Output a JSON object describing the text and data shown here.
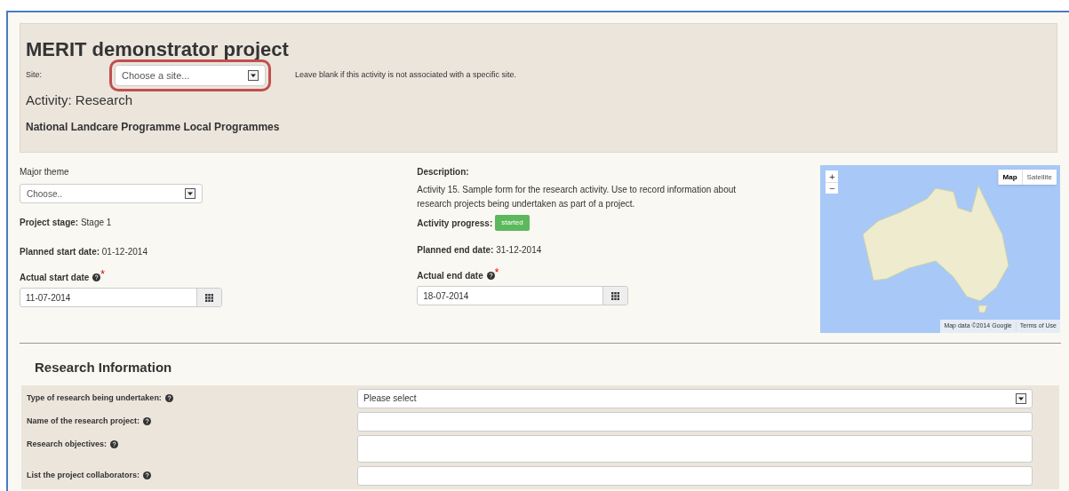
{
  "header": {
    "title": "MERIT demonstrator project",
    "site_label": "Site:",
    "site_placeholder": "Choose a site...",
    "site_hint": "Leave blank if this activity is not associated with a specific site.",
    "activity": "Activity: Research",
    "programme": "National Landcare Programme Local Programmes"
  },
  "left": {
    "theme_label": "Major theme",
    "theme_placeholder": "Choose..",
    "stage_label": "Project stage:",
    "stage_value": "Stage 1",
    "planned_start_label": "Planned start date:",
    "planned_start_value": "01-12-2014",
    "actual_start_label": "Actual start date",
    "actual_start_mark": "*",
    "actual_start_value": "11-07-2014"
  },
  "middle": {
    "description_label": "Description:",
    "description": "Activity 15. Sample form for the research activity. Use to record information about research projects being undertaken as part of a project.",
    "progress_label": "Activity progress:",
    "progress_badge": "started",
    "planned_end_label": "Planned end date:",
    "planned_end_value": "31-12-2014",
    "actual_end_label": "Actual end date",
    "actual_end_mark": "*",
    "actual_end_value": "18-07-2014"
  },
  "map": {
    "zoom_in": "+",
    "zoom_out": "−",
    "types": [
      {
        "label": "Map",
        "selected": true
      },
      {
        "label": "Satellite",
        "selected": false
      }
    ],
    "attribution": "Map data ©2014 Google",
    "terms": "Terms of Use"
  },
  "research": {
    "title": "Research Information",
    "rows": [
      {
        "label": "Type of research being undertaken:",
        "kind": "select",
        "placeholder": "Please select"
      },
      {
        "label": "Name of the research project:",
        "kind": "text"
      },
      {
        "label": "Research objectives:",
        "kind": "textarea"
      },
      {
        "label": "List the project collaborators:",
        "kind": "text"
      }
    ]
  }
}
